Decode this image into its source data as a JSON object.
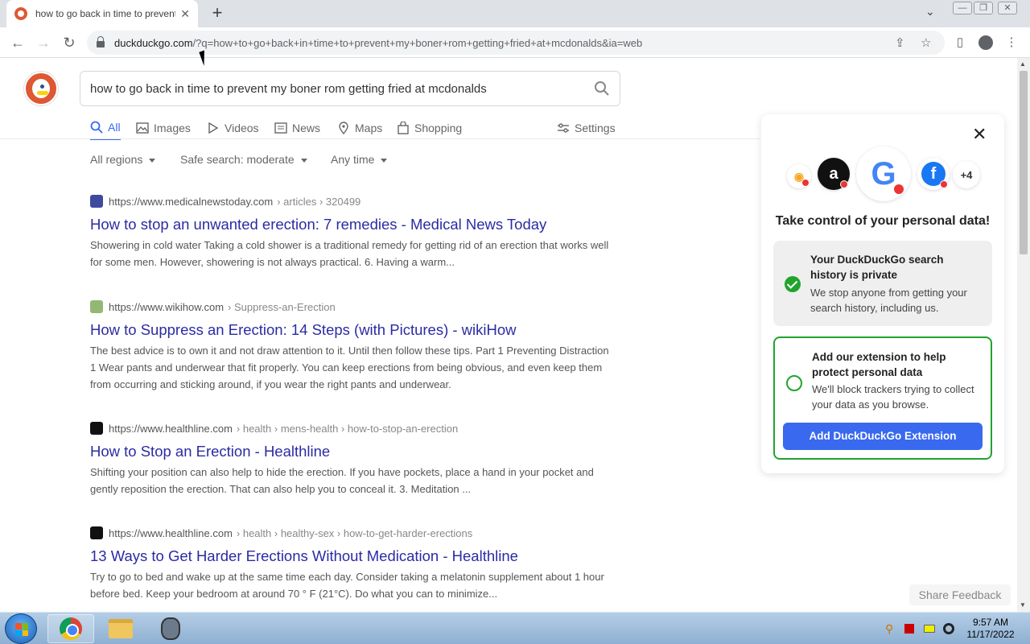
{
  "browser": {
    "tab_title": "how to go back in time to prevent my boner rom getting fried at mcdonalds",
    "url_host": "duckduckgo.com",
    "url_path": "/?q=how+to+go+back+in+time+to+prevent+my+boner+rom+getting+fried+at+mcdonalds&ia=web"
  },
  "search": {
    "query": "how to go back in time to prevent my boner rom getting fried at mcdonalds"
  },
  "tabs": [
    {
      "label": "All",
      "icon": "search-icon"
    },
    {
      "label": "Images",
      "icon": "image-icon"
    },
    {
      "label": "Videos",
      "icon": "play-icon"
    },
    {
      "label": "News",
      "icon": "newspaper-icon"
    },
    {
      "label": "Maps",
      "icon": "map-pin-icon"
    },
    {
      "label": "Shopping",
      "icon": "shopping-bag-icon"
    },
    {
      "label": "Settings",
      "icon": "sliders-icon"
    }
  ],
  "filters": [
    {
      "label": "All regions"
    },
    {
      "label": "Safe search: moderate"
    },
    {
      "label": "Any time"
    }
  ],
  "results": [
    {
      "host": "https://www.medicalnewstoday.com",
      "crumbs": "› articles › 320499",
      "title": "How to stop an unwanted erection: 7 remedies - Medical News Today",
      "snippet": "Showering in cold water Taking a cold shower is a traditional remedy for getting rid of an erection that works well for some men. However, showering is not always practical. 6. Having a warm...",
      "favicon_color": "#3e4a9e"
    },
    {
      "host": "https://www.wikihow.com",
      "crumbs": "› Suppress-an-Erection",
      "title": "How to Suppress an Erection: 14 Steps (with Pictures) - wikiHow",
      "snippet": "The best advice is to own it and not draw attention to it. Until then follow these tips. Part 1 Preventing Distraction 1 Wear pants and underwear that fit properly. You can keep erections from being obvious, and even keep them from occurring and sticking around, if you wear the right pants and underwear.",
      "favicon_color": "#93b874"
    },
    {
      "host": "https://www.healthline.com",
      "crumbs": "› health › mens-health › how-to-stop-an-erection",
      "title": "How to Stop an Erection - Healthline",
      "snippet": "Shifting your position can also help to hide the erection. If you have pockets, place a hand in your pocket and gently reposition the erection. That can also help you to conceal it. 3. Meditation ...",
      "favicon_color": "#111111"
    },
    {
      "host": "https://www.healthline.com",
      "crumbs": "› health › healthy-sex › how-to-get-harder-erections",
      "title": "13 Ways to Get Harder Erections Without Medication - Healthline",
      "snippet": "Try to go to bed and wake up at the same time each day. Consider taking a melatonin supplement about 1 hour before bed. Keep your bedroom at around 70 ° F (21°C). Do what you can to minimize...",
      "favicon_color": "#111111"
    }
  ],
  "privacy_card": {
    "more_count": "+4",
    "heading": "Take control of your personal data!",
    "step1_title": "Your DuckDuckGo search history is private",
    "step1_text": "We stop anyone from getting your search history, including us.",
    "step2_title": "Add our extension to help protect personal data",
    "step2_text": "We'll block trackers trying to collect your data as you browse.",
    "button": "Add DuckDuckGo Extension"
  },
  "feedback": "Share Feedback",
  "taskbar": {
    "time": "9:57 AM",
    "date": "11/17/2022"
  },
  "colors": {
    "accent": "#3969ef",
    "link": "#2b2ba5",
    "brand_orange": "#de5833",
    "success": "#21a42d"
  }
}
